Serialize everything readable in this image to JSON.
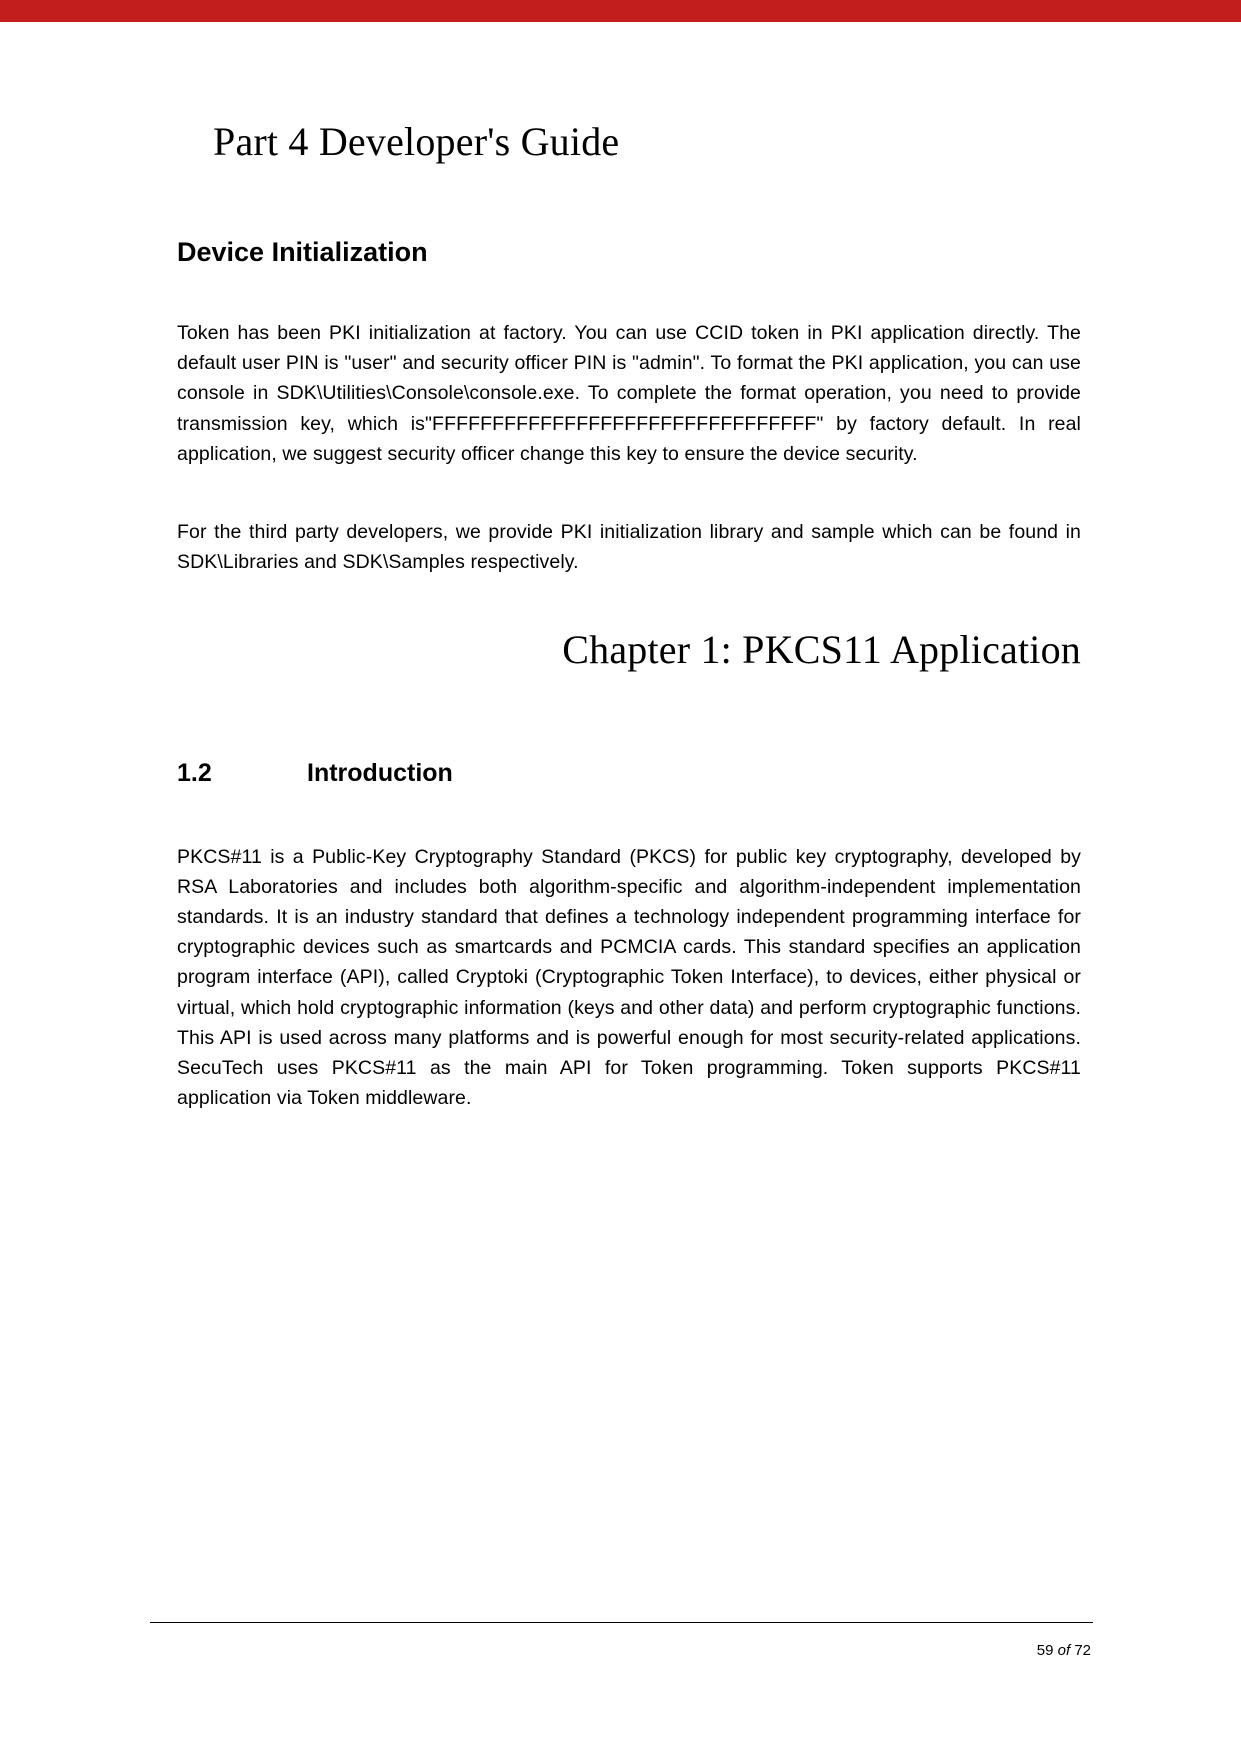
{
  "part_title": "Part 4 Developer's Guide",
  "section_heading": "Device Initialization",
  "para1": "Token has been PKI initialization at factory. You can use CCID token in PKI application directly. The default user PIN is \"user\" and security officer PIN is \"admin\". To format the PKI application, you can use console in SDK\\Utilities\\Console\\console.exe. To complete the format operation, you need to provide transmission key, which is\"FFFFFFFFFFFFFFFFFFFFFFFFFFFFFFFF\" by factory default. In real application, we suggest security officer change this key to ensure the device security.",
  "para2": "For the third party developers, we provide PKI initialization library and sample which can be found in SDK\\Libraries and SDK\\Samples respectively.",
  "chapter_title": "Chapter 1: PKCS11 Application",
  "sub_num": "1.2",
  "sub_text": "Introduction",
  "para3": "PKCS#11 is a Public-Key Cryptography Standard (PKCS) for public key cryptography, developed by RSA Laboratories and includes both algorithm-specific and algorithm-independent implementation standards. It is an industry standard that defines a technology independent programming interface for cryptographic devices such as smartcards and PCMCIA cards. This standard specifies an application program interface (API), called Cryptoki (Cryptographic Token Interface), to devices, either physical or virtual, which hold cryptographic information (keys and other data) and perform cryptographic functions. This API is used across many platforms and is powerful enough for most security-related applications. SecuTech uses PKCS#11 as the main API for Token programming. Token supports PKCS#11 application via Token middleware.",
  "page": {
    "current": "59",
    "of": "of",
    "total": "72"
  }
}
